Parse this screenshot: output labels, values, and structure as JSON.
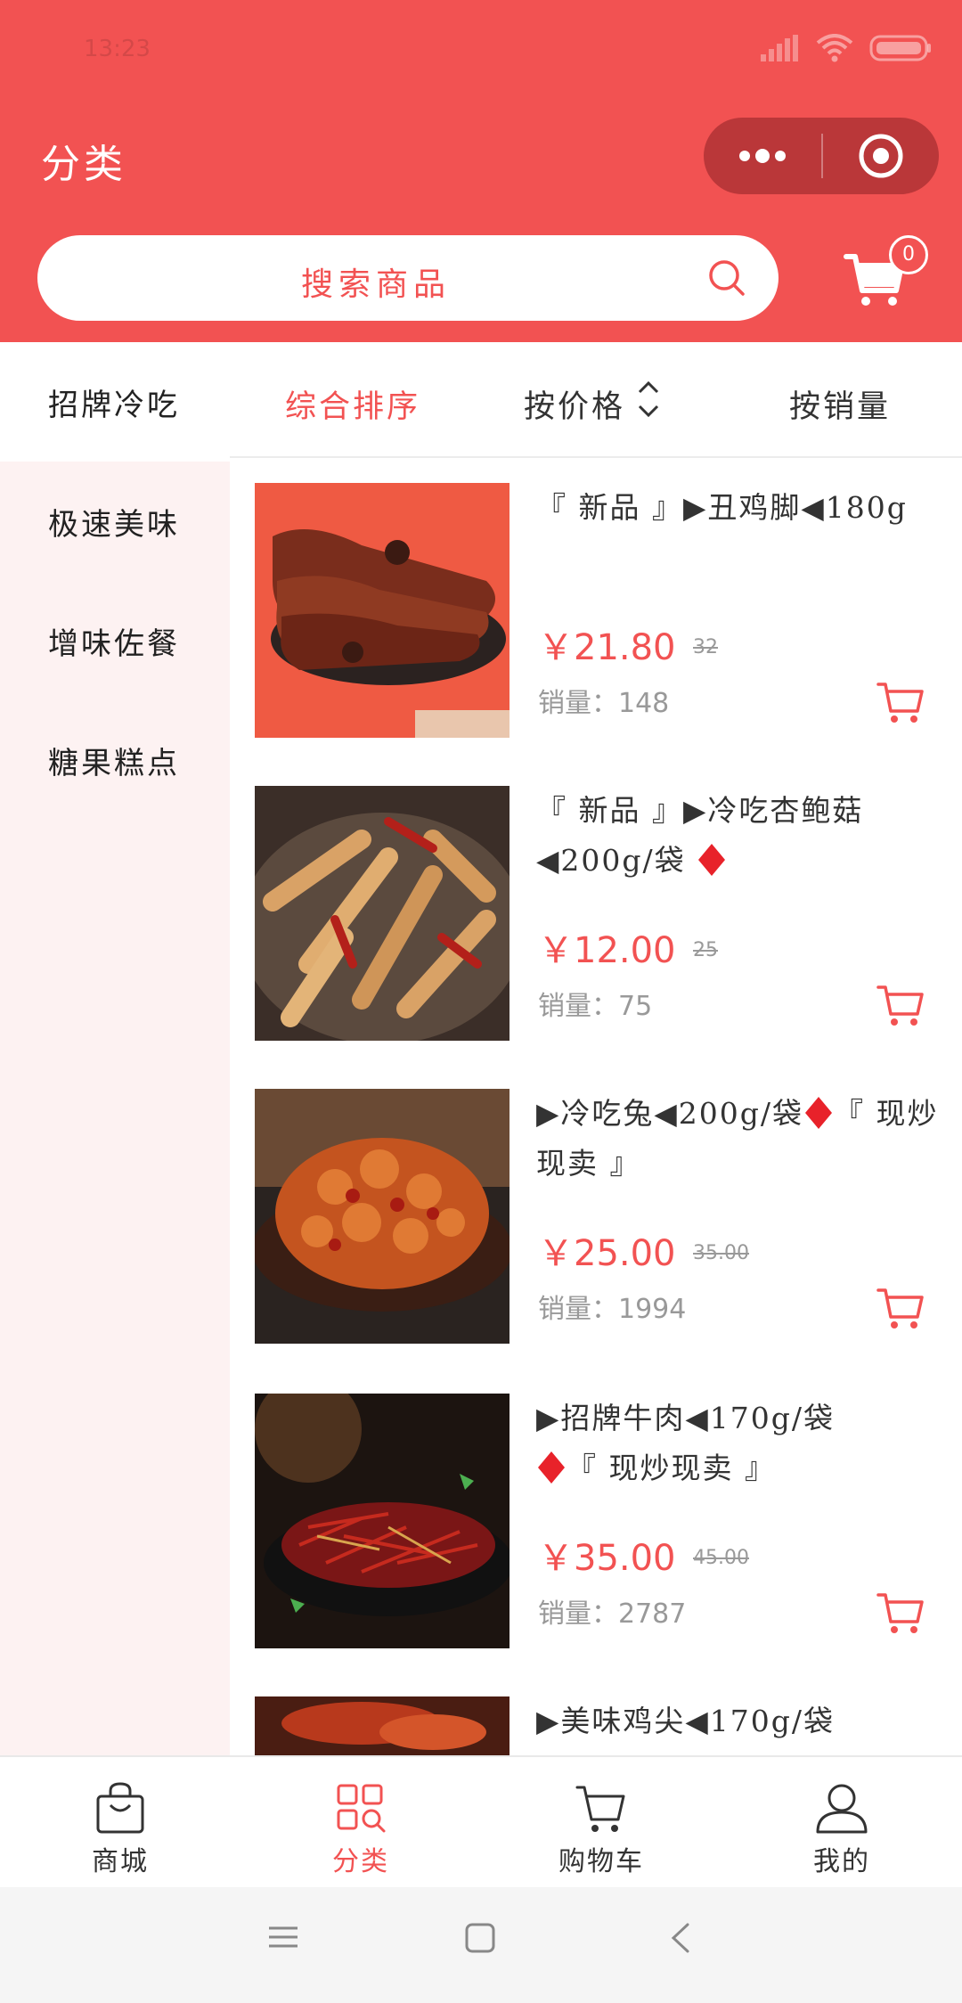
{
  "status": {
    "time": "13:23"
  },
  "header": {
    "title": "分类"
  },
  "search": {
    "placeholder": "搜索商品"
  },
  "cart": {
    "badge": "0"
  },
  "sidebar": {
    "items": [
      {
        "label": "招牌冷吃",
        "active": true
      },
      {
        "label": "极速美味"
      },
      {
        "label": "增味佐餐"
      },
      {
        "label": "糖果糕点"
      }
    ]
  },
  "sort": {
    "comprehensive": "综合排序",
    "price": "按价格",
    "sales": "按销量"
  },
  "products": [
    {
      "title": "『 新品 』▶丑鸡脚◀180g",
      "price": "￥21.80",
      "old_price": "32",
      "sales_label": "销量：",
      "sales": "148"
    },
    {
      "title": "『 新品 』▶冷吃杏鲍菇◀200g/袋",
      "price": "￥12.00",
      "old_price": "25",
      "sales_label": "销量：",
      "sales": "75"
    },
    {
      "title": "▶冷吃兔◀200g/袋",
      "title_tail": "『 现炒现卖 』",
      "price": "￥25.00",
      "old_price": "35.00",
      "sales_label": "销量：",
      "sales": "1994"
    },
    {
      "title": "▶招牌牛肉◀170g/袋",
      "title_tail": "『 现炒现卖 』",
      "price": "￥35.00",
      "old_price": "45.00",
      "sales_label": "销量：",
      "sales": "2787"
    },
    {
      "title": "▶美味鸡尖◀170g/袋"
    }
  ],
  "tabs": [
    {
      "label": "商城"
    },
    {
      "label": "分类",
      "active": true
    },
    {
      "label": "购物车"
    },
    {
      "label": "我的"
    }
  ],
  "colors": {
    "brand": "#f25252",
    "sidebar_bg": "#fdf2f2"
  }
}
